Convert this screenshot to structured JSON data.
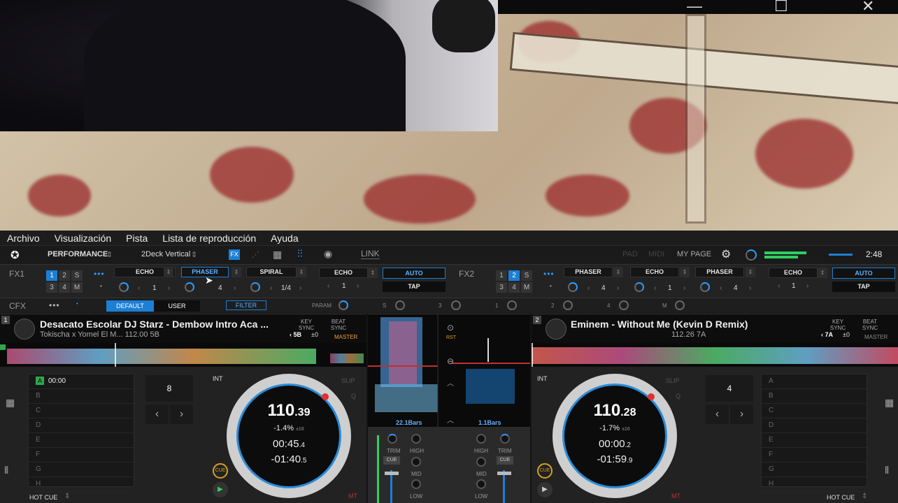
{
  "window": {
    "minimize": "—",
    "maximize": "☐",
    "close": "✕"
  },
  "menu": [
    "Archivo",
    "Visualización",
    "Pista",
    "Lista de reproducción",
    "Ayuda"
  ],
  "toolbar": {
    "layout_mode": "PERFORMANCE",
    "deck_mode": "2Deck Vertical",
    "link": "LINK",
    "pad": "PAD",
    "midi": "MIDI",
    "my_page": "MY PAGE",
    "time": "2:48"
  },
  "fx1": {
    "label": "FX1",
    "grid": [
      "1",
      "2",
      "S",
      "3",
      "4",
      "M"
    ],
    "slots": [
      "ECHO",
      "PHASER",
      "SPIRAL",
      "ECHO"
    ],
    "values": [
      "1",
      "4",
      "1/4",
      "1"
    ],
    "auto": "AUTO",
    "tap": "TAP"
  },
  "fx2": {
    "label": "FX2",
    "grid": [
      "1",
      "2",
      "S",
      "3",
      "4",
      "M"
    ],
    "slots": [
      "PHASER",
      "ECHO",
      "PHASER",
      "ECHO"
    ],
    "values": [
      "4",
      "1",
      "4",
      "1"
    ],
    "auto": "AUTO",
    "tap": "TAP"
  },
  "cfx": {
    "label": "CFX",
    "default": "DEFAULT",
    "user": "USER",
    "filter": "FILTER",
    "param": "PARAM",
    "knobs": [
      "S",
      "3",
      "1",
      "2",
      "4",
      "M"
    ]
  },
  "deck1": {
    "number": "1",
    "title": "Desacato Escolar  DJ Starz - Dembow Intro Aca ...",
    "artist_line": "Tokischa x Yomel El M...  112.00  5B",
    "key_sync": "KEY SYNC",
    "key": "5B",
    "key_offset": "±0",
    "beat_sync": "BEAT SYNC",
    "master": "MASTER",
    "bpm_int": "110",
    "bpm_dec": ".39",
    "pitch": "-1.4%",
    "pitch_range": "±16",
    "elapsed": "00:45",
    "elapsed_dec": ".4",
    "remain": "-01:40",
    "remain_dec": ".5",
    "int": "INT",
    "slip": "SLIP",
    "q": "Q",
    "cue_btn": "CUE",
    "mt": "MT",
    "beat_count": "8",
    "hot_cue_label": "HOT CUE",
    "cues": [
      {
        "letter": "A",
        "time": "00:00"
      },
      {
        "letter": "B",
        "time": ""
      },
      {
        "letter": "C",
        "time": ""
      },
      {
        "letter": "D",
        "time": ""
      },
      {
        "letter": "E",
        "time": ""
      },
      {
        "letter": "F",
        "time": ""
      },
      {
        "letter": "G",
        "time": ""
      },
      {
        "letter": "H",
        "time": ""
      }
    ]
  },
  "deck2": {
    "number": "2",
    "title": "Eminem - Without Me (Kevin D Remix)",
    "artist_line": "112.26  7A",
    "key_sync": "KEY SYNC",
    "key": "7A",
    "key_offset": "±0",
    "beat_sync": "BEAT SYNC",
    "master": "MASTER",
    "bpm_int": "110",
    "bpm_dec": ".28",
    "pitch": "-1.7%",
    "pitch_range": "±16",
    "elapsed": "00:00",
    "elapsed_dec": ".2",
    "remain": "-01:59",
    "remain_dec": ".9",
    "int": "INT",
    "slip": "SLIP",
    "q": "Q",
    "cue_btn": "CUE",
    "mt": "MT",
    "beat_count": "4",
    "hot_cue_label": "HOT CUE",
    "cues": [
      "A",
      "B",
      "C",
      "D",
      "E",
      "F",
      "G",
      "H"
    ]
  },
  "mixer": {
    "bars_left": "22.1Bars",
    "bars_right": "1.1Bars",
    "rst": "RST",
    "trim": "TRIM",
    "high": "HIGH",
    "mid": "MID",
    "low": "LOW",
    "cue": "CUE"
  },
  "colors": {
    "accent": "#1c7fd6",
    "master": "#f0a030",
    "hotcue_set": "#2fa84a",
    "cue_ring": "#d8a020"
  }
}
